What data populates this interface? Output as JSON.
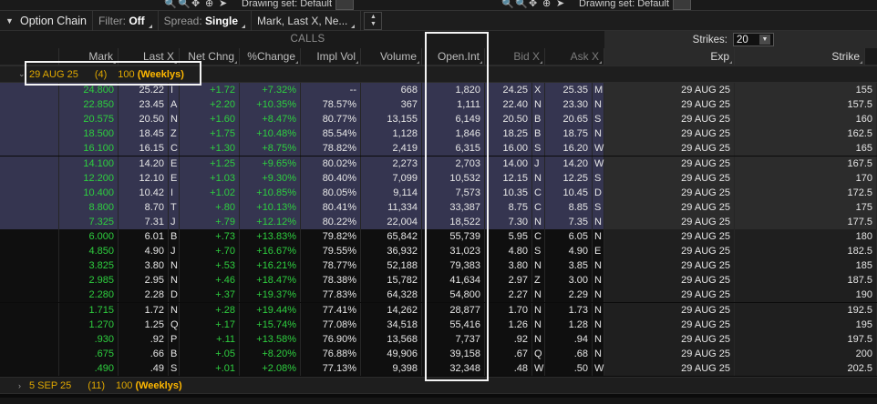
{
  "toolbar": {
    "title": "Option Chain",
    "filter_label": "Filter:",
    "filter_value": "Off",
    "spread_label": "Spread:",
    "spread_value": "Single",
    "price_fields": "Mark, Last X, Ne..."
  },
  "top_strip": {
    "drawing_set_left": "Drawing set: Default",
    "drawing_set_right": "Drawing set: Default"
  },
  "calls_header": "CALLS",
  "strikes": {
    "label": "Strikes:",
    "value": "20"
  },
  "columns": {
    "mark": "Mark",
    "last": "Last X",
    "net": "Net Chng",
    "pct": "%Change",
    "iv": "Impl Vol",
    "vol": "Volume",
    "oi": "Open.Int",
    "bid": "Bid X",
    "ask": "Ask X",
    "exp": "Exp",
    "strike": "Strike"
  },
  "groups": [
    {
      "date": "29 AUG 25",
      "count": "(4)",
      "label": "100 (Weeklys)"
    },
    {
      "date": "5 SEP 25",
      "count": "(11)",
      "label": "100 (Weeklys)"
    }
  ],
  "rows": [
    {
      "mark": "24.800",
      "last": "25.22",
      "lx": "I",
      "net": "+1.72",
      "pct": "+7.32%",
      "iv": "--",
      "vol": "668",
      "oi": "1,820",
      "bid": "24.25",
      "bx": "X",
      "ask": "25.35",
      "ax": "M",
      "exp": "29 AUG 25",
      "strike": "155",
      "itm": true
    },
    {
      "mark": "22.850",
      "last": "23.45",
      "lx": "A",
      "net": "+2.20",
      "pct": "+10.35%",
      "iv": "78.57%",
      "vol": "367",
      "oi": "1,111",
      "bid": "22.40",
      "bx": "N",
      "ask": "23.30",
      "ax": "N",
      "exp": "29 AUG 25",
      "strike": "157.5",
      "itm": true
    },
    {
      "mark": "20.575",
      "last": "20.50",
      "lx": "N",
      "net": "+1.60",
      "pct": "+8.47%",
      "iv": "80.77%",
      "vol": "13,155",
      "oi": "6,149",
      "bid": "20.50",
      "bx": "B",
      "ask": "20.65",
      "ax": "S",
      "exp": "29 AUG 25",
      "strike": "160",
      "itm": true
    },
    {
      "mark": "18.500",
      "last": "18.45",
      "lx": "Z",
      "net": "+1.75",
      "pct": "+10.48%",
      "iv": "85.54%",
      "vol": "1,128",
      "oi": "1,846",
      "bid": "18.25",
      "bx": "B",
      "ask": "18.75",
      "ax": "N",
      "exp": "29 AUG 25",
      "strike": "162.5",
      "itm": true
    },
    {
      "mark": "16.100",
      "last": "16.15",
      "lx": "C",
      "net": "+1.30",
      "pct": "+8.75%",
      "iv": "78.82%",
      "vol": "2,419",
      "oi": "6,315",
      "bid": "16.00",
      "bx": "S",
      "ask": "16.20",
      "ax": "W",
      "exp": "29 AUG 25",
      "strike": "165",
      "itm": true
    },
    {
      "mark": "14.100",
      "last": "14.20",
      "lx": "E",
      "net": "+1.25",
      "pct": "+9.65%",
      "iv": "80.02%",
      "vol": "2,273",
      "oi": "2,703",
      "bid": "14.00",
      "bx": "J",
      "ask": "14.20",
      "ax": "W",
      "exp": "29 AUG 25",
      "strike": "167.5",
      "itm": true
    },
    {
      "mark": "12.200",
      "last": "12.10",
      "lx": "E",
      "net": "+1.03",
      "pct": "+9.30%",
      "iv": "80.40%",
      "vol": "7,099",
      "oi": "10,532",
      "bid": "12.15",
      "bx": "N",
      "ask": "12.25",
      "ax": "S",
      "exp": "29 AUG 25",
      "strike": "170",
      "itm": true
    },
    {
      "mark": "10.400",
      "last": "10.42",
      "lx": "I",
      "net": "+1.02",
      "pct": "+10.85%",
      "iv": "80.05%",
      "vol": "9,114",
      "oi": "7,573",
      "bid": "10.35",
      "bx": "C",
      "ask": "10.45",
      "ax": "D",
      "exp": "29 AUG 25",
      "strike": "172.5",
      "itm": true
    },
    {
      "mark": "8.800",
      "last": "8.70",
      "lx": "T",
      "net": "+.80",
      "pct": "+10.13%",
      "iv": "80.41%",
      "vol": "11,334",
      "oi": "33,387",
      "bid": "8.75",
      "bx": "C",
      "ask": "8.85",
      "ax": "S",
      "exp": "29 AUG 25",
      "strike": "175",
      "itm": true
    },
    {
      "mark": "7.325",
      "last": "7.31",
      "lx": "J",
      "net": "+.79",
      "pct": "+12.12%",
      "iv": "80.22%",
      "vol": "22,004",
      "oi": "18,522",
      "bid": "7.30",
      "bx": "N",
      "ask": "7.35",
      "ax": "N",
      "exp": "29 AUG 25",
      "strike": "177.5",
      "itm": true
    },
    {
      "mark": "6.000",
      "last": "6.01",
      "lx": "B",
      "net": "+.73",
      "pct": "+13.83%",
      "iv": "79.82%",
      "vol": "65,842",
      "oi": "55,739",
      "bid": "5.95",
      "bx": "C",
      "ask": "6.05",
      "ax": "N",
      "exp": "29 AUG 25",
      "strike": "180",
      "itm": false
    },
    {
      "mark": "4.850",
      "last": "4.90",
      "lx": "J",
      "net": "+.70",
      "pct": "+16.67%",
      "iv": "79.55%",
      "vol": "36,932",
      "oi": "31,023",
      "bid": "4.80",
      "bx": "S",
      "ask": "4.90",
      "ax": "E",
      "exp": "29 AUG 25",
      "strike": "182.5",
      "itm": false
    },
    {
      "mark": "3.825",
      "last": "3.80",
      "lx": "N",
      "net": "+.53",
      "pct": "+16.21%",
      "iv": "78.77%",
      "vol": "52,188",
      "oi": "79,383",
      "bid": "3.80",
      "bx": "N",
      "ask": "3.85",
      "ax": "N",
      "exp": "29 AUG 25",
      "strike": "185",
      "itm": false
    },
    {
      "mark": "2.985",
      "last": "2.95",
      "lx": "N",
      "net": "+.46",
      "pct": "+18.47%",
      "iv": "78.38%",
      "vol": "15,782",
      "oi": "41,634",
      "bid": "2.97",
      "bx": "Z",
      "ask": "3.00",
      "ax": "N",
      "exp": "29 AUG 25",
      "strike": "187.5",
      "itm": false
    },
    {
      "mark": "2.280",
      "last": "2.28",
      "lx": "D",
      "net": "+.37",
      "pct": "+19.37%",
      "iv": "77.83%",
      "vol": "64,328",
      "oi": "54,800",
      "bid": "2.27",
      "bx": "N",
      "ask": "2.29",
      "ax": "N",
      "exp": "29 AUG 25",
      "strike": "190",
      "itm": false
    },
    {
      "mark": "1.715",
      "last": "1.72",
      "lx": "N",
      "net": "+.28",
      "pct": "+19.44%",
      "iv": "77.41%",
      "vol": "14,262",
      "oi": "28,877",
      "bid": "1.70",
      "bx": "N",
      "ask": "1.73",
      "ax": "N",
      "exp": "29 AUG 25",
      "strike": "192.5",
      "itm": false
    },
    {
      "mark": "1.270",
      "last": "1.25",
      "lx": "Q",
      "net": "+.17",
      "pct": "+15.74%",
      "iv": "77.08%",
      "vol": "34,518",
      "oi": "55,416",
      "bid": "1.26",
      "bx": "N",
      "ask": "1.28",
      "ax": "N",
      "exp": "29 AUG 25",
      "strike": "195",
      "itm": false
    },
    {
      "mark": ".930",
      "last": ".92",
      "lx": "P",
      "net": "+.11",
      "pct": "+13.58%",
      "iv": "76.90%",
      "vol": "13,568",
      "oi": "7,737",
      "bid": ".92",
      "bx": "N",
      "ask": ".94",
      "ax": "N",
      "exp": "29 AUG 25",
      "strike": "197.5",
      "itm": false
    },
    {
      "mark": ".675",
      "last": ".66",
      "lx": "B",
      "net": "+.05",
      "pct": "+8.20%",
      "iv": "76.88%",
      "vol": "49,906",
      "oi": "39,158",
      "bid": ".67",
      "bx": "Q",
      "ask": ".68",
      "ax": "N",
      "exp": "29 AUG 25",
      "strike": "200",
      "itm": false
    },
    {
      "mark": ".490",
      "last": ".49",
      "lx": "S",
      "net": "+.01",
      "pct": "+2.08%",
      "iv": "77.13%",
      "vol": "9,398",
      "oi": "32,348",
      "bid": ".48",
      "bx": "W",
      "ask": ".50",
      "ax": "W",
      "exp": "29 AUG 25",
      "strike": "202.5",
      "itm": false
    }
  ]
}
